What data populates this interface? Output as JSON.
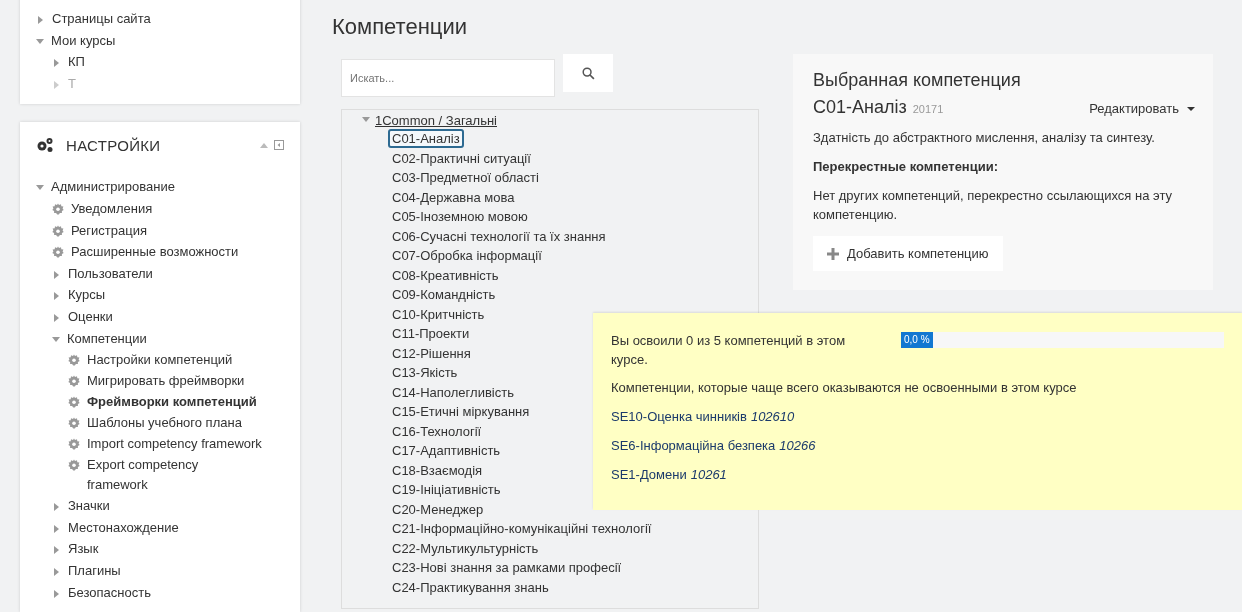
{
  "navigation": {
    "items": [
      {
        "label": "Страницы сайта",
        "expanded": false,
        "dimmed": false
      },
      {
        "label": "Мои курсы",
        "expanded": true,
        "dimmed": false,
        "children": [
          {
            "label": "КП",
            "expanded": false,
            "dimmed": false
          },
          {
            "label": "Т",
            "expanded": false,
            "dimmed": true
          }
        ]
      }
    ]
  },
  "settings": {
    "title": "НАСТРОЙКИ",
    "items": [
      {
        "label": "Администрирование",
        "kind": "folder",
        "expanded": true,
        "selected": false,
        "children": [
          {
            "label": "Уведомления",
            "kind": "page",
            "selected": false
          },
          {
            "label": "Регистрация",
            "kind": "page",
            "selected": false
          },
          {
            "label": "Расширенные возможности",
            "kind": "page",
            "selected": false
          },
          {
            "label": "Пользователи",
            "kind": "folder",
            "expanded": false,
            "selected": false
          },
          {
            "label": "Курсы",
            "kind": "folder",
            "expanded": false,
            "selected": false
          },
          {
            "label": "Оценки",
            "kind": "folder",
            "expanded": false,
            "selected": false
          },
          {
            "label": "Компетенции",
            "kind": "folder",
            "expanded": true,
            "selected": false,
            "children": [
              {
                "label": "Настройки компетенций",
                "kind": "page",
                "selected": false
              },
              {
                "label": "Мигрировать фреймворки",
                "kind": "page",
                "selected": false
              },
              {
                "label": "Фреймворки компетенций",
                "kind": "page",
                "selected": true
              },
              {
                "label": "Шаблоны учебного плана",
                "kind": "page",
                "selected": false
              },
              {
                "label": "Import competency framework",
                "kind": "page",
                "selected": false
              },
              {
                "label": "Export competency framework",
                "kind": "page",
                "selected": false
              }
            ]
          },
          {
            "label": "Значки",
            "kind": "folder",
            "expanded": false,
            "selected": false
          },
          {
            "label": "Местонахождение",
            "kind": "folder",
            "expanded": false,
            "selected": false
          },
          {
            "label": "Язык",
            "kind": "folder",
            "expanded": false,
            "selected": false
          },
          {
            "label": "Плагины",
            "kind": "folder",
            "expanded": false,
            "selected": false
          },
          {
            "label": "Безопасность",
            "kind": "folder",
            "expanded": false,
            "selected": false
          }
        ]
      }
    ]
  },
  "page": {
    "title": "Компетенции",
    "search": {
      "placeholder": "Искать..."
    }
  },
  "tree": {
    "root": {
      "label": "1Common / Загальні",
      "expanded": true
    },
    "items": [
      {
        "label": "C01-Аналіз",
        "selected": true
      },
      {
        "label": "C02-Практичні ситуації",
        "selected": false
      },
      {
        "label": "C03-Предметної області",
        "selected": false
      },
      {
        "label": "C04-Державна мова",
        "selected": false
      },
      {
        "label": "C05-Іноземною мовою",
        "selected": false
      },
      {
        "label": "C06-Сучасні технології та їх знання",
        "selected": false
      },
      {
        "label": "C07-Обробка інформації",
        "selected": false
      },
      {
        "label": "C08-Креативність",
        "selected": false
      },
      {
        "label": "C09-Командність",
        "selected": false
      },
      {
        "label": "C10-Критчність",
        "selected": false
      },
      {
        "label": "C11-Проекти",
        "selected": false
      },
      {
        "label": "C12-Рішення",
        "selected": false
      },
      {
        "label": "C13-Якість",
        "selected": false
      },
      {
        "label": "C14-Наполегливість",
        "selected": false
      },
      {
        "label": "C15-Етичні міркування",
        "selected": false
      },
      {
        "label": "C16-Технології",
        "selected": false
      },
      {
        "label": "C17-Адаптивність",
        "selected": false
      },
      {
        "label": "C18-Взаємодія",
        "selected": false
      },
      {
        "label": "C19-Ініціативність",
        "selected": false
      },
      {
        "label": "C20-Менеджер",
        "selected": false
      },
      {
        "label": "C21-Інформаційно-комунікаційні технології",
        "selected": false
      },
      {
        "label": "C22-Мультикультурність",
        "selected": false
      },
      {
        "label": "C23-Нові знання за рамками професії",
        "selected": false
      },
      {
        "label": "C24-Практикування знань",
        "selected": false
      }
    ]
  },
  "selected_competency": {
    "heading": "Выбранная компетенция",
    "name": "C01-Аналіз",
    "id": "20171",
    "edit_menu": "Редактировать",
    "description": "Здатність до абстрактного мислення, аналізу та синтезу.",
    "cross_heading": "Перекрестные компетенции:",
    "cross_text": "Нет других компетенций, перекрестно ссылающихся на эту компетенцию.",
    "add_button": "Добавить компетенцию"
  },
  "course_summary": {
    "progress_text": "Вы освоили 0 из 5 компетенций в этом курсе.",
    "progress": {
      "label": "0,0 %",
      "level": 0
    },
    "frequent_heading": "Компетенции, которые чаще всего оказываются не освоенными в этом курсе",
    "items": [
      {
        "name": "SE10-Оценка чинників",
        "code": "102610"
      },
      {
        "name": "SE6-Інформаційна безпека",
        "code": "10266"
      },
      {
        "name": "SE1-Домени",
        "code": "10261"
      }
    ]
  }
}
